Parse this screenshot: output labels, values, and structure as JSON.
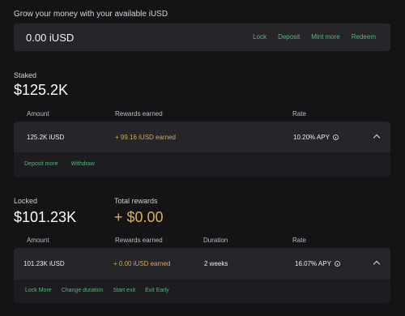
{
  "intro": "Grow your money with your available iUSD",
  "balance": {
    "value": "0.00 iUSD",
    "actions": [
      "Lock",
      "Deposit",
      "Mint more",
      "Redeem"
    ]
  },
  "staked": {
    "label": "Staked",
    "value": "$125.2K",
    "columns": [
      "Amount",
      "Rewards earned",
      "Rate"
    ],
    "row": {
      "amount": "125.2K iUSD",
      "rewards": "+ 99.16 iUSD earned",
      "rate": "10.20% APY"
    },
    "actions": [
      "Deposit more",
      "Withdraw"
    ]
  },
  "locked": {
    "label": "Locked",
    "value": "$101.23K",
    "total_rewards_label": "Total rewards",
    "total_rewards_value": "+ $0.00",
    "columns": [
      "Amount",
      "Rewards earned",
      "Duration",
      "Rate"
    ],
    "row": {
      "amount": "101.23K iUSD",
      "rewards": "+ 0.00 iUSD earned",
      "duration": "2 weeks",
      "rate": "16.07% APY"
    },
    "actions": [
      "Lock More",
      "Change duration",
      "Start exit",
      "Exit Early"
    ]
  },
  "colors": {
    "background": "#141316",
    "card": "#26252a",
    "link_green": "#52b97a",
    "gold": "#e0b050"
  }
}
